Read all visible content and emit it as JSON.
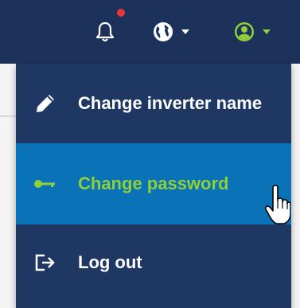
{
  "header": {
    "icons": [
      "bell-icon",
      "globe-icon",
      "user-circle-icon"
    ],
    "notification_dot_color": "#e53935",
    "background_color": "#1c325a"
  },
  "menu": {
    "items": [
      {
        "label": "Change inverter name",
        "icon": "pencil-icon"
      },
      {
        "label": "Change password",
        "icon": "key-icon",
        "state": "hovered"
      },
      {
        "label": "Log out",
        "icon": "logout-icon"
      }
    ],
    "background_color": "#1f3763",
    "hover_color": "#0a73b7",
    "hover_text_color": "#8ecf3a"
  },
  "cursor": {
    "type": "hand-pointer-icon"
  }
}
